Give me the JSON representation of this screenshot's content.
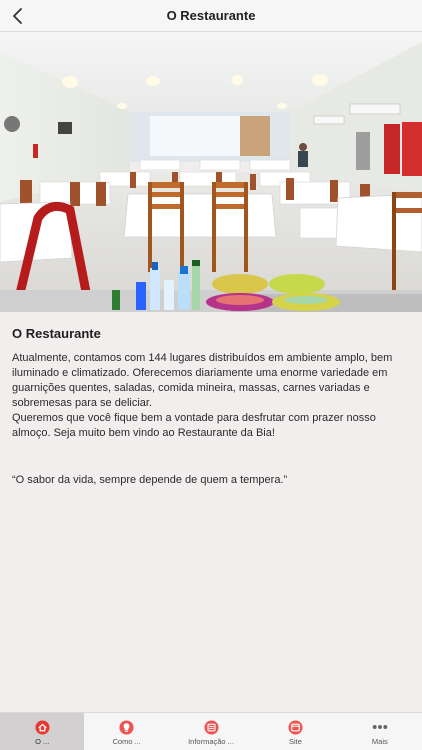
{
  "navbar": {
    "title": "O Restaurante",
    "back_icon": "chevron-left-icon"
  },
  "hero": {
    "alt": "restaurant-interior-photo"
  },
  "content": {
    "title": "O Restaurante",
    "paragraph": "Atualmente, contamos com 144 lugares distribuídos em ambiente amplo, bem iluminado e climatizado. Oferecemos diariamente uma enorme variedade em guarnições quentes, saladas, comida mineira, massas, carnes variadas e sobremesas para se deliciar.",
    "paragraph2": "Queremos que você fique bem a vontade para desfrutar com prazer nosso almoço. Seja muito bem vindo ao Restaurante da Bia!",
    "quote": "“O sabor da vida, sempre depende de quem a tempera.”"
  },
  "tabbar": {
    "accent": "#e53935",
    "tabs": [
      {
        "label": "O ...",
        "icon": "home-icon",
        "active": true
      },
      {
        "label": "Como ...",
        "icon": "lightbulb-icon",
        "active": false
      },
      {
        "label": "Informação ...",
        "icon": "info-box-icon",
        "active": false
      },
      {
        "label": "Site",
        "icon": "browser-icon",
        "active": false
      },
      {
        "label": "Mais",
        "icon": "more-dots-icon",
        "active": false
      }
    ]
  }
}
